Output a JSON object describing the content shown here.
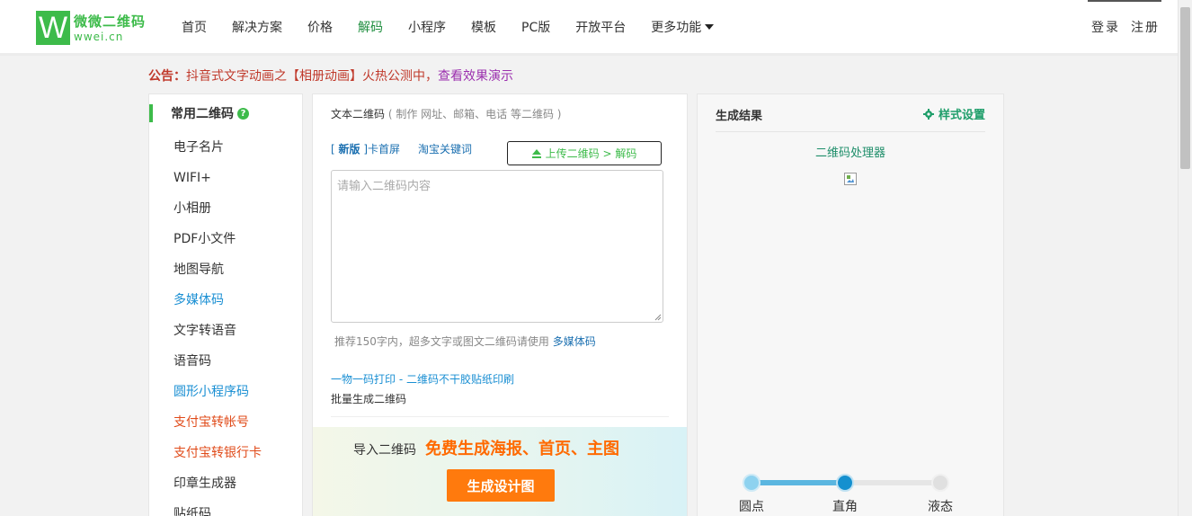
{
  "header": {
    "logo_mark": "W",
    "logo_name": "微微二维码",
    "logo_domain": "wwei.cn",
    "nav": [
      "首页",
      "解决方案",
      "价格",
      "解码",
      "小程序",
      "模板",
      "PC版",
      "开放平台",
      "更多功能"
    ],
    "active_nav": "解码",
    "login": "登录",
    "register": "注册"
  },
  "notice": {
    "label": "公告：",
    "text": "抖音式文字动画之【相册动画】火热公测中，",
    "link": "查看效果演示"
  },
  "sidebar": {
    "heading": "常用二维码",
    "help": "?",
    "items": [
      {
        "label": "电子名片",
        "tone": "normal"
      },
      {
        "label": "WIFI+",
        "tone": "normal"
      },
      {
        "label": "小相册",
        "tone": "normal"
      },
      {
        "label": "PDF小文件",
        "tone": "normal"
      },
      {
        "label": "地图导航",
        "tone": "normal"
      },
      {
        "label": "多媒体码",
        "tone": "blue"
      },
      {
        "label": "文字转语音",
        "tone": "normal"
      },
      {
        "label": "语音码",
        "tone": "normal"
      },
      {
        "label": "圆形小程序码",
        "tone": "blue"
      },
      {
        "label": "支付宝转帐号",
        "tone": "red"
      },
      {
        "label": "支付宝转银行卡",
        "tone": "red"
      },
      {
        "label": "印章生成器",
        "tone": "normal"
      },
      {
        "label": "贴纸码",
        "tone": "normal"
      }
    ]
  },
  "editor": {
    "title": "文本二维码",
    "subtitle": "( 制作 网址、邮箱、电话 等二维码 )",
    "tab_new_bracket_open": "[ ",
    "tab_new_badge": "新版",
    "tab_new_rest": " ]卡首屏",
    "tab_taobao": "淘宝关键词",
    "upload": "上传二维码 > 解码",
    "placeholder": "请输入二维码内容",
    "value": "",
    "hint": "推荐150字内，超多文字或图文二维码请使用",
    "hint_link": "多媒体码",
    "print_link": "一物一码打印 - 二维码不干胶贴纸印刷",
    "batch_link": "批量生成二维码",
    "promo_a": "导入二维码",
    "promo_b": "免费生成海报、首页、主图",
    "design_button": "生成设计图"
  },
  "result": {
    "title": "生成结果",
    "style_settings": "样式设置",
    "processor": "二维码处理器",
    "slider": {
      "options": [
        "圆点",
        "直角",
        "液态"
      ],
      "selected": "直角",
      "value_fraction": 0.5
    }
  },
  "colors": {
    "brand_green": "#3dbb4a",
    "notice_red": "#c0392b",
    "promo_orange": "#ff7a0d",
    "slider_blue": "#1590cf"
  }
}
